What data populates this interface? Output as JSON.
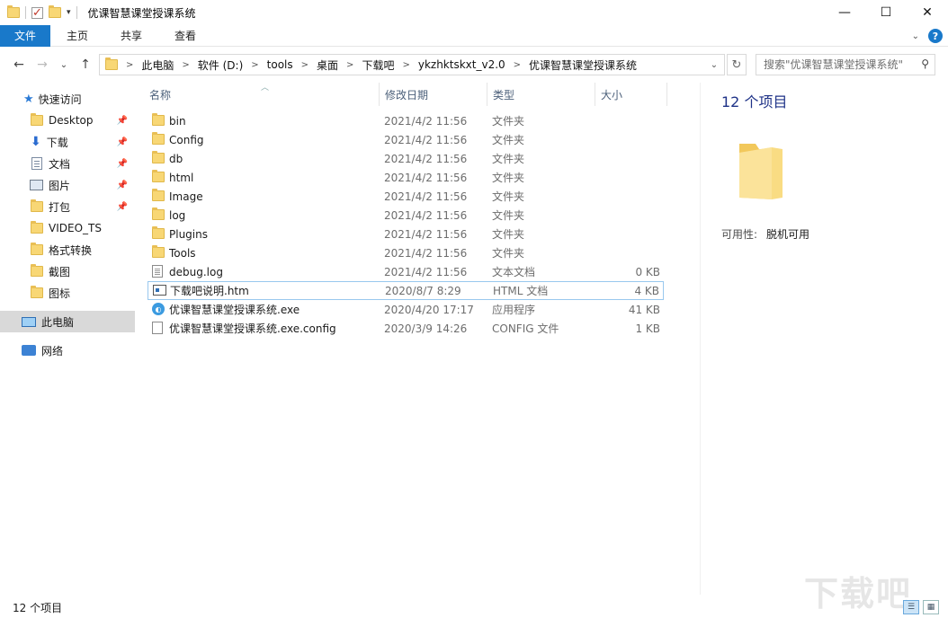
{
  "window": {
    "title": "优课智慧课堂授课系统",
    "controls": {
      "minimize": "—",
      "maximize": "☐",
      "close": "✕"
    }
  },
  "ribbon": {
    "tabs": [
      {
        "label": "文件"
      },
      {
        "label": "主页"
      },
      {
        "label": "共享"
      },
      {
        "label": "查看"
      }
    ],
    "help_label": "?"
  },
  "nav": {
    "back": "←",
    "forward": "→",
    "recent": "⌄",
    "up": "↑"
  },
  "address": {
    "crumbs": [
      "此电脑",
      "软件 (D:)",
      "tools",
      "桌面",
      "下载吧",
      "ykzhktskxt_v2.0",
      "优课智慧课堂授课系统"
    ]
  },
  "search": {
    "placeholder": "搜索\"优课智慧课堂授课系统\""
  },
  "navpane": {
    "quick_access": "快速访问",
    "items": [
      {
        "label": "Desktop",
        "icon": "folder-icon",
        "pinned": true
      },
      {
        "label": "下载",
        "icon": "download-icon",
        "pinned": true
      },
      {
        "label": "文档",
        "icon": "document-icon",
        "pinned": true
      },
      {
        "label": "图片",
        "icon": "picture-icon",
        "pinned": true
      },
      {
        "label": "打包",
        "icon": "folder-icon",
        "pinned": true
      },
      {
        "label": "VIDEO_TS",
        "icon": "folder-icon",
        "pinned": false
      },
      {
        "label": "格式转换",
        "icon": "folder-icon",
        "pinned": false
      },
      {
        "label": "截图",
        "icon": "folder-icon",
        "pinned": false
      },
      {
        "label": "图标",
        "icon": "folder-icon",
        "pinned": false
      }
    ],
    "this_pc": "此电脑",
    "network": "网络"
  },
  "columns": {
    "name": "名称",
    "date": "修改日期",
    "type": "类型",
    "size": "大小"
  },
  "files": [
    {
      "name": "bin",
      "date": "2021/4/2 11:56",
      "type": "文件夹",
      "size": "",
      "icon": "folder-icon"
    },
    {
      "name": "Config",
      "date": "2021/4/2 11:56",
      "type": "文件夹",
      "size": "",
      "icon": "folder-icon"
    },
    {
      "name": "db",
      "date": "2021/4/2 11:56",
      "type": "文件夹",
      "size": "",
      "icon": "folder-icon"
    },
    {
      "name": "html",
      "date": "2021/4/2 11:56",
      "type": "文件夹",
      "size": "",
      "icon": "folder-icon"
    },
    {
      "name": "Image",
      "date": "2021/4/2 11:56",
      "type": "文件夹",
      "size": "",
      "icon": "folder-icon"
    },
    {
      "name": "log",
      "date": "2021/4/2 11:56",
      "type": "文件夹",
      "size": "",
      "icon": "folder-icon"
    },
    {
      "name": "Plugins",
      "date": "2021/4/2 11:56",
      "type": "文件夹",
      "size": "",
      "icon": "folder-icon"
    },
    {
      "name": "Tools",
      "date": "2021/4/2 11:56",
      "type": "文件夹",
      "size": "",
      "icon": "folder-icon"
    },
    {
      "name": "debug.log",
      "date": "2021/4/2 11:56",
      "type": "文本文档",
      "size": "0 KB",
      "icon": "log-file-icon"
    },
    {
      "name": "下载吧说明.htm",
      "date": "2020/8/7 8:29",
      "type": "HTML 文档",
      "size": "4 KB",
      "icon": "html-file-icon"
    },
    {
      "name": "优课智慧课堂授课系统.exe",
      "date": "2020/4/20 17:17",
      "type": "应用程序",
      "size": "41 KB",
      "icon": "exe-file-icon"
    },
    {
      "name": "优课智慧课堂授课系统.exe.config",
      "date": "2020/3/9 14:26",
      "type": "CONFIG 文件",
      "size": "1 KB",
      "icon": "config-file-icon"
    }
  ],
  "details": {
    "count": "12 个项目",
    "availability_label": "可用性:",
    "availability_value": "脱机可用"
  },
  "status": {
    "count": "12 个项目"
  },
  "watermark": "下载吧"
}
